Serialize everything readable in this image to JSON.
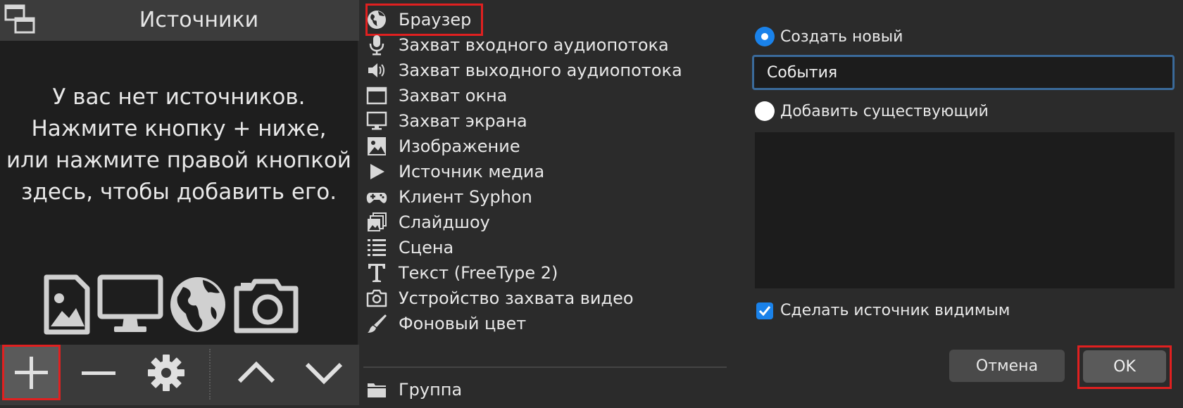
{
  "sources": {
    "title": "Источники",
    "empty_message": [
      "У вас нет источников.",
      "Нажмите кнопку + ниже,",
      "или нажмите правой кнопкой",
      "здесь, чтобы добавить его."
    ],
    "toolbar": {
      "add_icon": "plus-icon",
      "remove_icon": "minus-icon",
      "settings_icon": "gear-icon",
      "up_icon": "chevron-up-icon",
      "down_icon": "chevron-down-icon"
    }
  },
  "type_menu": {
    "items": [
      {
        "label": "Браузер",
        "icon": "globe-icon"
      },
      {
        "label": "Захват входного аудиопотока",
        "icon": "microphone-icon"
      },
      {
        "label": "Захват выходного аудиопотока",
        "icon": "speaker-icon"
      },
      {
        "label": "Захват окна",
        "icon": "window-icon"
      },
      {
        "label": "Захват экрана",
        "icon": "monitor-icon"
      },
      {
        "label": "Изображение",
        "icon": "image-icon"
      },
      {
        "label": "Источник медиа",
        "icon": "play-icon"
      },
      {
        "label": "Клиент Syphon",
        "icon": "gamepad-icon"
      },
      {
        "label": "Слайдшоу",
        "icon": "slideshow-icon"
      },
      {
        "label": "Сцена",
        "icon": "list-icon"
      },
      {
        "label": "Текст (FreeType 2)",
        "icon": "text-icon"
      },
      {
        "label": "Устройство захвата видео",
        "icon": "camera-icon"
      },
      {
        "label": "Фоновый цвет",
        "icon": "brush-icon"
      }
    ],
    "group": {
      "label": "Группа",
      "icon": "folder-icon"
    }
  },
  "create_source": {
    "create_new_label": "Создать новый",
    "name_value": "События",
    "add_existing_label": "Добавить существующий",
    "make_visible_label": "Сделать источник видимым",
    "cancel_label": "Отмена",
    "ok_label": "OK"
  },
  "colors": {
    "accent": "#1a82ea",
    "highlight": "#e02020"
  }
}
